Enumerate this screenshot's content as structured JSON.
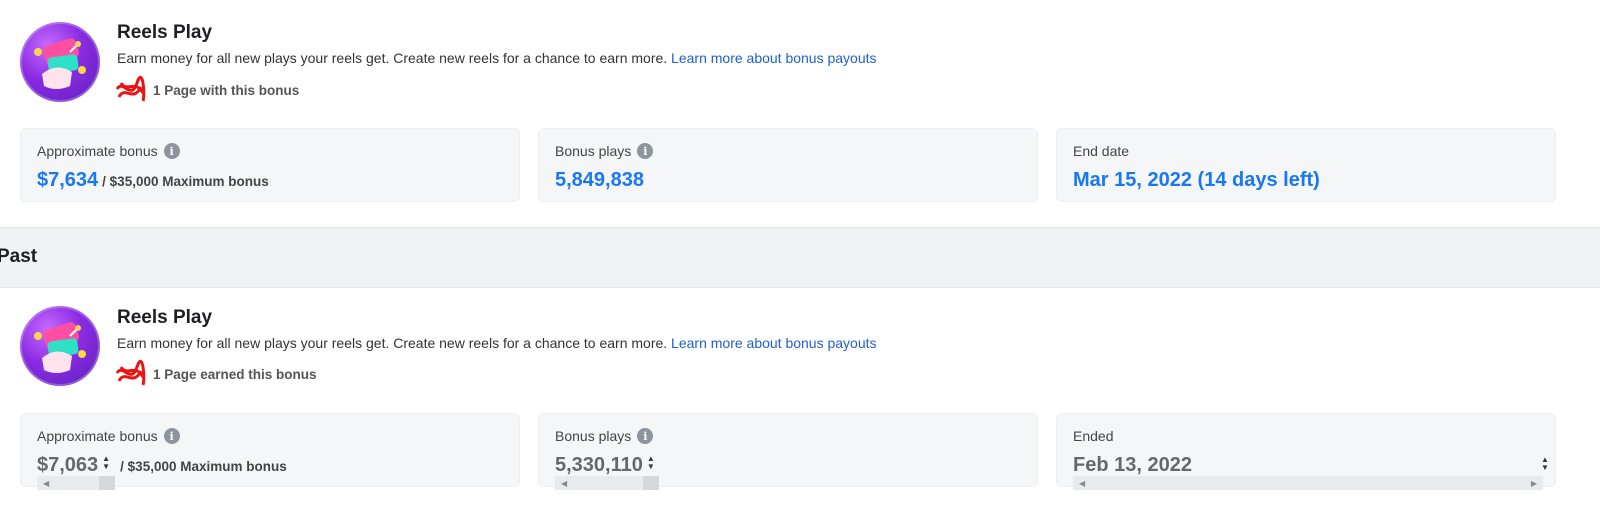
{
  "current": {
    "title": "Reels Play",
    "description": "Earn money for all new plays your reels get. Create new reels for a chance to earn more.",
    "link": "Learn more about bonus payouts",
    "pages_text": "1 Page with this bonus",
    "approx_label": "Approximate bonus",
    "approx_value": "$7,634",
    "approx_max": "/ $35,000 Maximum bonus",
    "plays_label": "Bonus plays",
    "plays_value": "5,849,838",
    "end_label": "End date",
    "end_value": "Mar 15, 2022 (14 days left)"
  },
  "section_label": "Past",
  "past": {
    "title": "Reels Play",
    "description": "Earn money for all new plays your reels get. Create new reels for a chance to earn more.",
    "link": "Learn more about bonus payouts",
    "pages_text": "1 Page earned this bonus",
    "approx_label": "Approximate bonus",
    "approx_value": "$7,063",
    "approx_max": "/ $35,000 Maximum bonus",
    "plays_label": "Bonus plays",
    "plays_value": "5,330,110",
    "end_label": "Ended",
    "end_value": "Feb 13, 2022"
  },
  "colors": {
    "accent": "#1877f2",
    "link": "#1f5fcf",
    "muted": "#65676b"
  }
}
